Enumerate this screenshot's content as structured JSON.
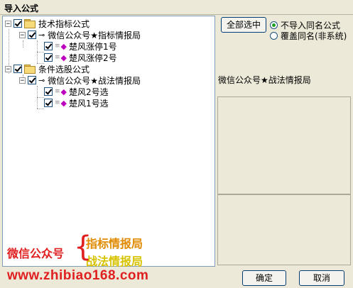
{
  "window": {
    "title": "导入公式"
  },
  "tree": {
    "group1": {
      "label": "技术指标公式",
      "expander": "−",
      "child": {
        "label": "微信公众号★指标情报局",
        "expander": "−",
        "items": [
          "楚风涨停1号",
          "楚风涨停2号"
        ]
      }
    },
    "group2": {
      "label": "条件选股公式",
      "expander": "−",
      "child": {
        "label": "微信公众号★战法情报局",
        "expander": "−",
        "items": [
          "楚风2号选",
          "楚风1号选"
        ]
      }
    }
  },
  "promo": {
    "left": "微信公众号",
    "brace": "{",
    "top": "指标情报局",
    "bottom": "战法情报局",
    "website": "www.zhibiao168.com"
  },
  "buttons": {
    "select_all": "全部选中",
    "ok": "确定",
    "cancel": "取消"
  },
  "options": [
    {
      "label": "不导入同名公式",
      "checked": true
    },
    {
      "label": "覆盖同名(非系统)",
      "checked": false
    }
  ],
  "info": {
    "title": "微信公众号★战法情报局"
  },
  "colors": {
    "promo_red": "#e02020",
    "promo_orange": "#e08a00",
    "promo_yellow": "#d8c300",
    "radio_green": "#21a121"
  }
}
